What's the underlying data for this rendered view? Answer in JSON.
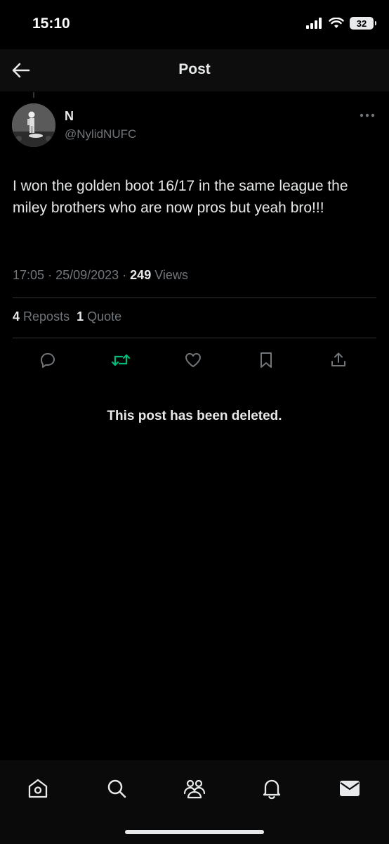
{
  "status_bar": {
    "time": "15:10",
    "battery": "32"
  },
  "header": {
    "title": "Post",
    "back_icon": "arrow-left-icon"
  },
  "post": {
    "author_name": "N",
    "author_handle": "@NylidNUFC",
    "text": "I won the golden boot 16/17 in the same league the miley brothers who are now pros but yeah bro!!!",
    "time": "17:05",
    "date": "25/09/2023",
    "views_count": "249",
    "views_label": "Views",
    "reposts_count": "4",
    "reposts_label": "Reposts",
    "quotes_count": "1",
    "quotes_label": "Quote"
  },
  "actions": [
    "reply-icon",
    "repost-icon",
    "like-icon",
    "bookmark-icon",
    "share-icon"
  ],
  "deleted_notice": "This post has been deleted.",
  "tabs": [
    "home-icon",
    "search-icon",
    "communities-icon",
    "notifications-icon",
    "messages-icon"
  ],
  "colors": {
    "background": "#000000",
    "text": "#e7e9ea",
    "secondary": "#71767b",
    "repost_active": "#00ba7c"
  }
}
